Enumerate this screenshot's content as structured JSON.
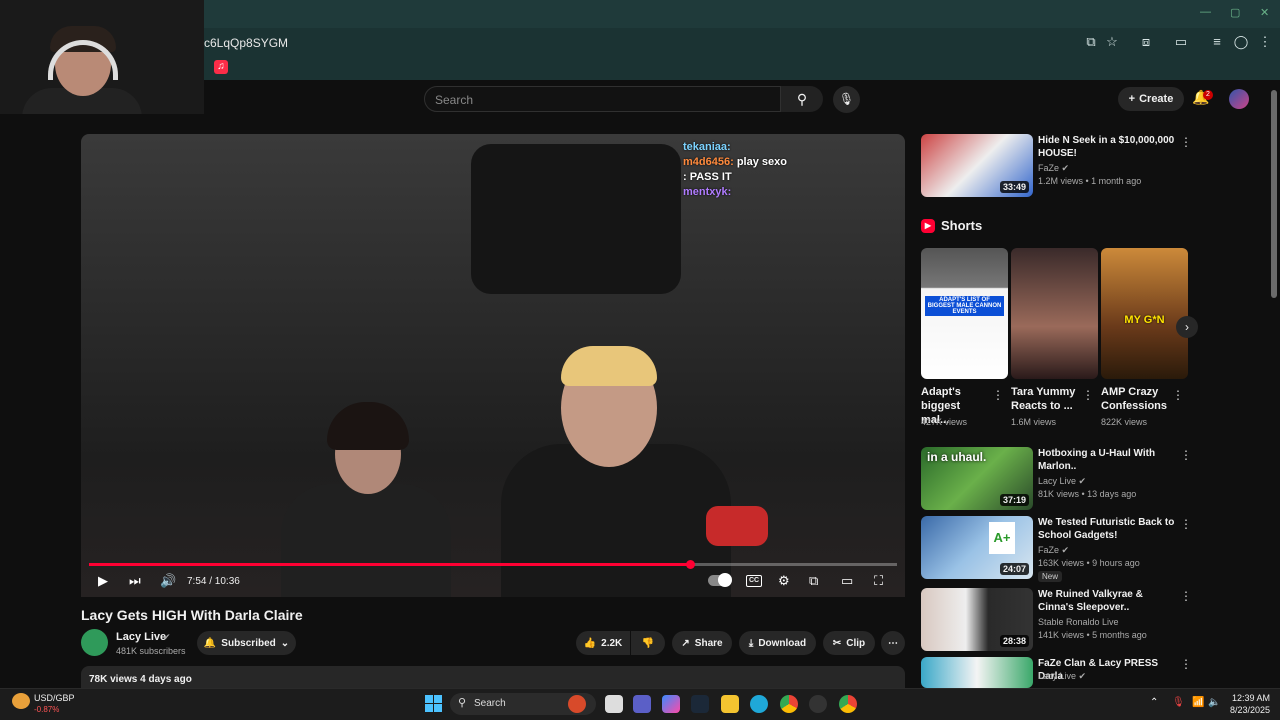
{
  "browser": {
    "url_fragment": "c6LqQp8SYGM"
  },
  "header": {
    "search_placeholder": "Search",
    "create_label": "Create",
    "notification_count": "2"
  },
  "player": {
    "progress_fraction": 0.7435,
    "time": "7:54 / 10:36",
    "chat": [
      {
        "user": "tekaniaa:",
        "msg": "",
        "color": "#7cd3ff"
      },
      {
        "user": "m4d6456:",
        "msg": "play sexo",
        "color": "#ff8a3d"
      },
      {
        "user": "",
        "msg": ": PASS IT",
        "color": "#b07cff"
      },
      {
        "user": "mentxyk:",
        "msg": "",
        "color": "#b07cff"
      }
    ]
  },
  "video": {
    "title": "Lacy Gets HIGH With Darla Claire",
    "channel": "Lacy Live",
    "subscribers": "481K subscribers",
    "subscribed_label": "Subscribed",
    "likes": "2.2K",
    "share_label": "Share",
    "download_label": "Download",
    "clip_label": "Clip",
    "views_date": "78K views  4 days ago"
  },
  "sidebar": {
    "top_item": {
      "title": "Hide N Seek in a $10,000,000 HOUSE!",
      "channel": "FaZe",
      "meta": "1.2M views • 1 month ago",
      "duration": "33:49"
    },
    "shorts_label": "Shorts",
    "shorts": [
      {
        "title": "Adapt's biggest mal...",
        "views": "427K views",
        "overlay": "ADAPT'S LIST OF BIGGEST MALE CANNON EVENTS"
      },
      {
        "title": "Tara Yummy Reacts to ...",
        "views": "1.6M views",
        "overlay": ""
      },
      {
        "title": "AMP Crazy Confessions",
        "views": "822K views",
        "overlay": "MY G*N"
      }
    ],
    "items": [
      {
        "title": "Hotboxing a U-Haul With Marlon..",
        "channel": "Lacy Live",
        "meta": "81K views • 13 days ago",
        "duration": "37:19",
        "thumb_text": "in a uhaul."
      },
      {
        "title": "We Tested Futuristic Back to School Gadgets!",
        "channel": "FaZe",
        "meta": "163K views • 9 hours ago",
        "duration": "24:07",
        "badge": "New",
        "thumb_text": "A+"
      },
      {
        "title": "We Ruined Valkyrae & Cinna's Sleepover..",
        "channel": "Stable Ronaldo Live",
        "meta": "141K views • 5 months ago",
        "duration": "28:38",
        "thumb_text": ""
      },
      {
        "title": "FaZe Clan & Lacy PRESS Darla",
        "channel": "Lacy Live",
        "meta": "",
        "duration": "",
        "thumb_text": ""
      }
    ]
  },
  "taskbar": {
    "ticker_name": "USD/GBP",
    "ticker_value": "-0.87%",
    "search_label": "Search",
    "time": "12:39 AM",
    "date": "8/23/2025"
  },
  "colors": {
    "accent": "#ff0033",
    "chrome_teal": "#1f3a3a"
  }
}
